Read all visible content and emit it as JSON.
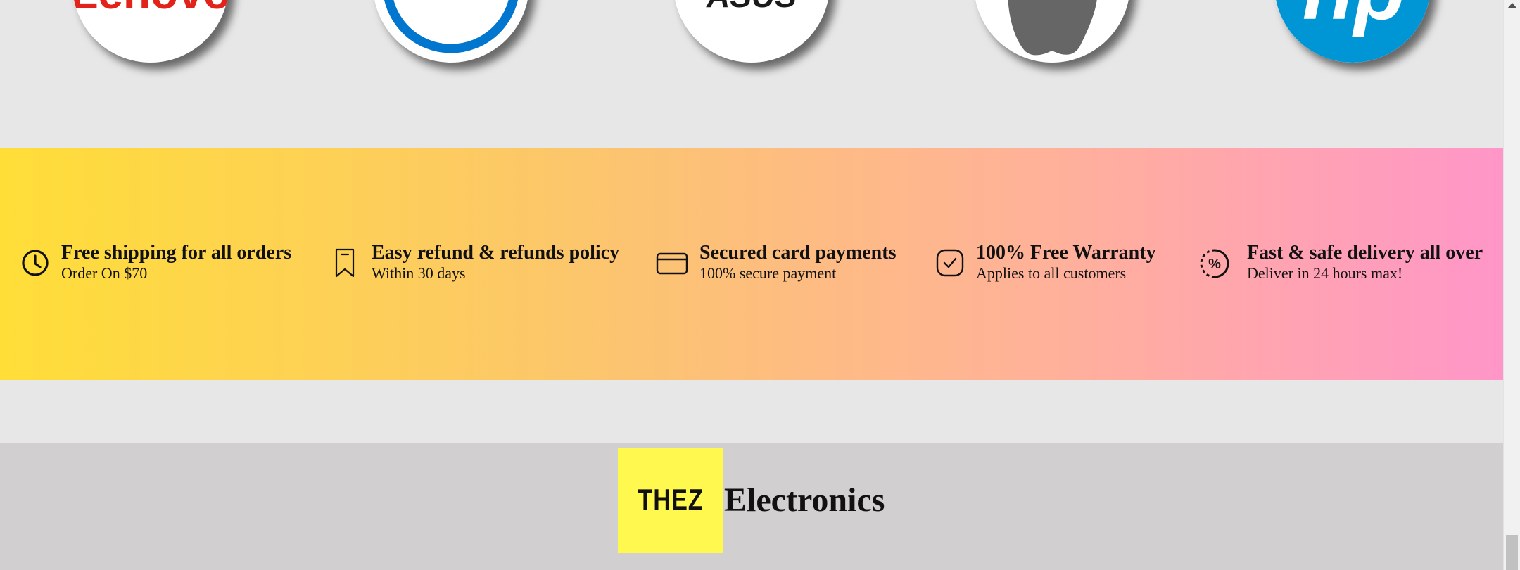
{
  "brands": [
    {
      "name": "Lenovo",
      "icon": "lenovo-logo-icon",
      "color": "#e2231a",
      "label": "Lenovo"
    },
    {
      "name": "Dell",
      "icon": "dell-logo-icon",
      "color": "#0076ce",
      "label": ""
    },
    {
      "name": "Asus",
      "icon": "asus-logo-icon",
      "color": "#1a1a1a",
      "label": "ASUS"
    },
    {
      "name": "Apple",
      "icon": "apple-logo-icon",
      "color": "#666666",
      "label": ""
    },
    {
      "name": "HP",
      "icon": "hp-logo-icon",
      "color": "#0096d6",
      "label": "hp"
    }
  ],
  "features": [
    {
      "icon": "clock-icon",
      "title": "Free shipping for all orders",
      "subtitle": "Order On $70"
    },
    {
      "icon": "bookmark-icon",
      "title": "Easy refund & refunds policy",
      "subtitle": "Within 30 days"
    },
    {
      "icon": "credit-card-icon",
      "title": "Secured card payments",
      "subtitle": "100% secure payment"
    },
    {
      "icon": "check-badge-icon",
      "title": "100% Free Warranty",
      "subtitle": "Applies to all customers"
    },
    {
      "icon": "percent-circle-icon",
      "title": "Fast & safe delivery all over",
      "subtitle": "Deliver in 24 hours max!"
    }
  ],
  "footer": {
    "logo_text": "THEZ",
    "brand_name": "Electronics",
    "logo_color": "#fff84e"
  },
  "colors": {
    "page_background": "#e7e7e7",
    "banner_gradient_start": "#ffde38",
    "banner_gradient_end": "#ff96c8",
    "footer_background": "#d1cfd0"
  }
}
